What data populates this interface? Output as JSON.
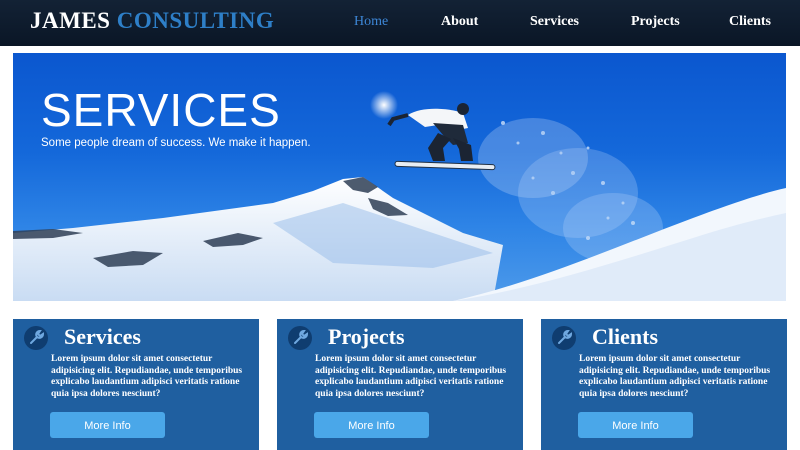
{
  "brand": {
    "word1": "JAMES",
    "word2": "CONSULTING"
  },
  "nav": {
    "items": [
      {
        "label": "Home",
        "active": true
      },
      {
        "label": "About",
        "active": false
      },
      {
        "label": "Services",
        "active": false
      },
      {
        "label": "Projects",
        "active": false
      },
      {
        "label": "Clients",
        "active": false
      }
    ]
  },
  "hero": {
    "title": "SERVICES",
    "subtitle": "Some people dream of success. We make it happen.",
    "image": "snowboarder-jumping-over-snowy-mountain"
  },
  "cards": [
    {
      "title": "Services",
      "icon": "wrench-icon",
      "text": "Lorem ipsum dolor sit amet consectetur adipisicing elit. Repudiandae, unde temporibus explicabo laudantium adipisci veritatis ratione quia ipsa dolores nesciunt?",
      "button": "More Info"
    },
    {
      "title": "Projects",
      "icon": "wrench-icon",
      "text": "Lorem ipsum dolor sit amet consectetur adipisicing elit. Repudiandae, unde temporibus explicabo laudantium adipisci veritatis ratione quia ipsa dolores nesciunt?",
      "button": "More Info"
    },
    {
      "title": "Clients",
      "icon": "wrench-icon",
      "text": "Lorem ipsum dolor sit amet consectetur adipisicing elit. Repudiandae, unde temporibus explicabo laudantium adipisci veritatis ratione quia ipsa dolores nesciunt?",
      "button": "More Info"
    }
  ],
  "colors": {
    "header_bg": "#0d1a2b",
    "brand_accent": "#2e7fc8",
    "nav_active": "#3d86d6",
    "card_bg": "#1f5fa0",
    "button_bg": "#4aa7e9"
  }
}
